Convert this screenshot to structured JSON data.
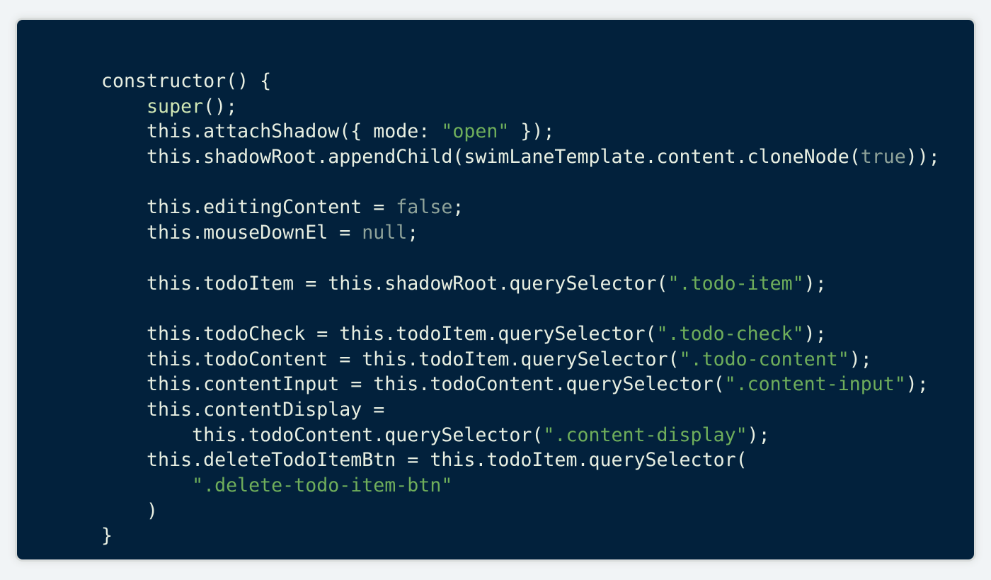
{
  "colors": {
    "background": "#f1f4f6",
    "editor_bg": "#02213c",
    "text": "#e8efe2",
    "string": "#6fae5b",
    "literal": "#8fa39a"
  },
  "code_lines": [
    [
      [
        "txt",
        "constructor() {"
      ]
    ],
    [
      [
        "txt",
        "    "
      ],
      [
        "kw",
        "super"
      ],
      [
        "txt",
        "();"
      ]
    ],
    [
      [
        "txt",
        "    this.attachShadow({ mode: "
      ],
      [
        "str",
        "\"open\""
      ],
      [
        "txt",
        " });"
      ]
    ],
    [
      [
        "txt",
        "    this.shadowRoot.appendChild(swimLaneTemplate.content.cloneNode("
      ],
      [
        "lit",
        "true"
      ],
      [
        "txt",
        "));"
      ]
    ],
    [],
    [
      [
        "txt",
        "    this.editingContent = "
      ],
      [
        "lit",
        "false"
      ],
      [
        "txt",
        ";"
      ]
    ],
    [
      [
        "txt",
        "    this.mouseDownEl = "
      ],
      [
        "lit",
        "null"
      ],
      [
        "txt",
        ";"
      ]
    ],
    [],
    [
      [
        "txt",
        "    this.todoItem = this.shadowRoot.querySelector("
      ],
      [
        "str",
        "\".todo-item\""
      ],
      [
        "txt",
        ");"
      ]
    ],
    [],
    [
      [
        "txt",
        "    this.todoCheck = this.todoItem.querySelector("
      ],
      [
        "str",
        "\".todo-check\""
      ],
      [
        "txt",
        ");"
      ]
    ],
    [
      [
        "txt",
        "    this.todoContent = this.todoItem.querySelector("
      ],
      [
        "str",
        "\".todo-content\""
      ],
      [
        "txt",
        ");"
      ]
    ],
    [
      [
        "txt",
        "    this.contentInput = this.todoContent.querySelector("
      ],
      [
        "str",
        "\".content-input\""
      ],
      [
        "txt",
        ");"
      ]
    ],
    [
      [
        "txt",
        "    this.contentDisplay ="
      ]
    ],
    [
      [
        "txt",
        "        this.todoContent.querySelector("
      ],
      [
        "str",
        "\".content-display\""
      ],
      [
        "txt",
        ");"
      ]
    ],
    [
      [
        "txt",
        "    this.deleteTodoItemBtn = this.todoItem.querySelector("
      ]
    ],
    [
      [
        "txt",
        "        "
      ],
      [
        "str",
        "\".delete-todo-item-btn\""
      ]
    ],
    [
      [
        "txt",
        "    )"
      ]
    ],
    [
      [
        "txt",
        "}"
      ]
    ]
  ]
}
